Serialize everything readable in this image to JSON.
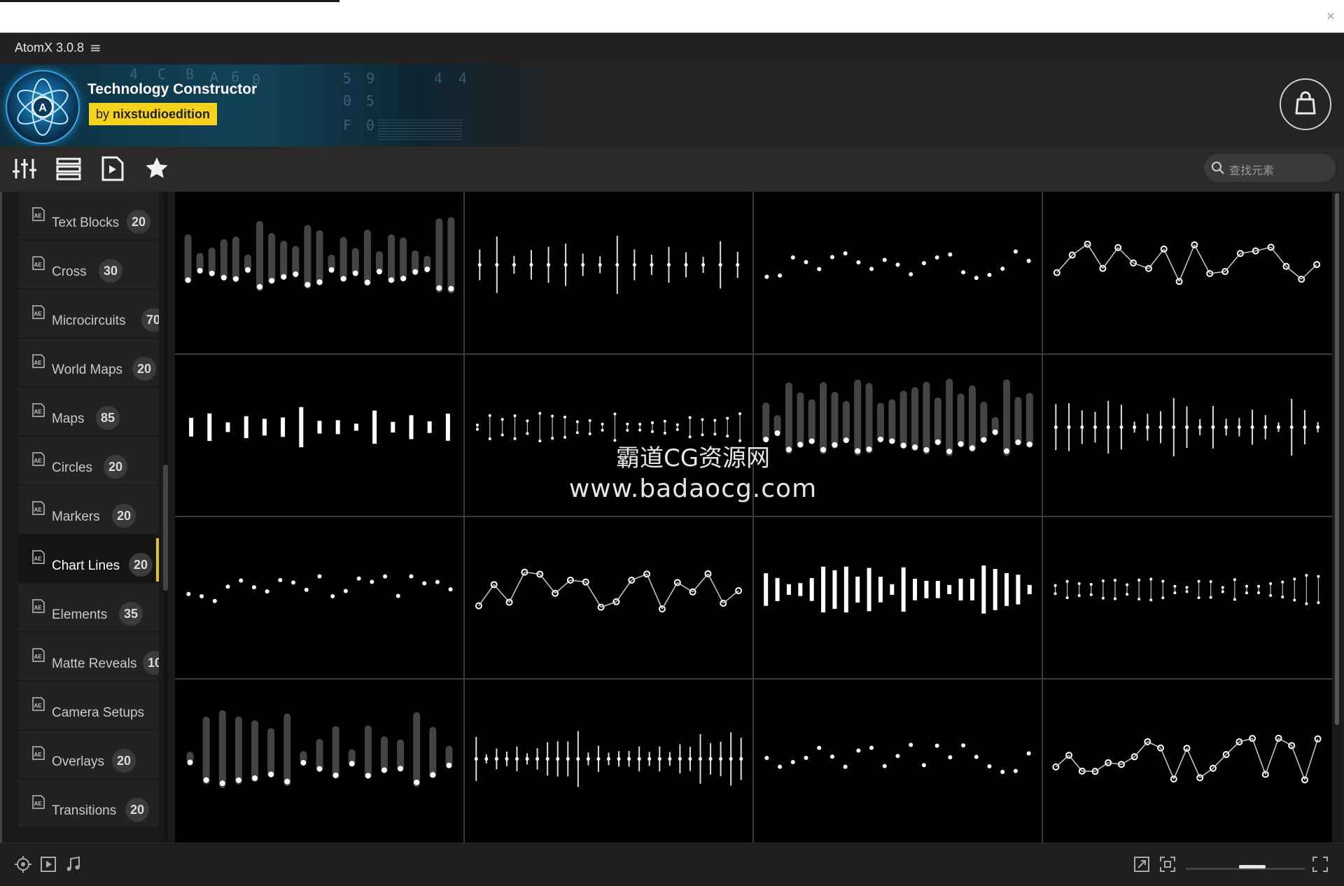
{
  "window": {
    "close_glyph": "×"
  },
  "titlebar": {
    "title": "AtomX 3.0.8",
    "menu_icon": "hamburger-icon"
  },
  "banner": {
    "pack_title": "Technology Constructor",
    "by_prefix": "by",
    "author": "nixstudioedition",
    "logo_letter": "A",
    "art_digits": [
      "4",
      "C",
      "B",
      "A",
      "6",
      "0",
      "5",
      "9",
      "4",
      "4",
      "0",
      "5",
      "F",
      "0"
    ],
    "cart_icon": "shopping-bag-icon"
  },
  "toolbar": {
    "icons": [
      "sliders-icon",
      "list-icon",
      "video-icon",
      "star-icon"
    ],
    "search_placeholder": "查找元素"
  },
  "sidebar": {
    "categories": [
      {
        "label": "Text Blocks",
        "count": "20"
      },
      {
        "label": "Cross",
        "count": "30"
      },
      {
        "label": "Microcircuits",
        "count": "70"
      },
      {
        "label": "World Maps",
        "count": "20"
      },
      {
        "label": "Maps",
        "count": "85"
      },
      {
        "label": "Circles",
        "count": "20"
      },
      {
        "label": "Markers",
        "count": "20"
      },
      {
        "label": "Chart Lines",
        "count": "20",
        "active": true
      },
      {
        "label": "Elements",
        "count": "35"
      },
      {
        "label": "Matte Reveals",
        "count": "10"
      },
      {
        "label": "Camera Setups",
        "count": ""
      },
      {
        "label": "Overlays",
        "count": "20"
      },
      {
        "label": "Transitions",
        "count": "20"
      }
    ],
    "ae_badge": "AE"
  },
  "watermark": {
    "line1": "霸道CG资源网",
    "line2": "www.badaocg.com"
  },
  "bottombar": {
    "left_icons": [
      "target-icon",
      "play-box-icon",
      "music-note-icon"
    ],
    "right_icons": [
      "resize-icon",
      "fit-icon",
      "fullscreen-icon"
    ]
  },
  "colors": {
    "accent": "#f5d31b",
    "background": "#1c1c1c",
    "thumb_bg": "#000000"
  }
}
